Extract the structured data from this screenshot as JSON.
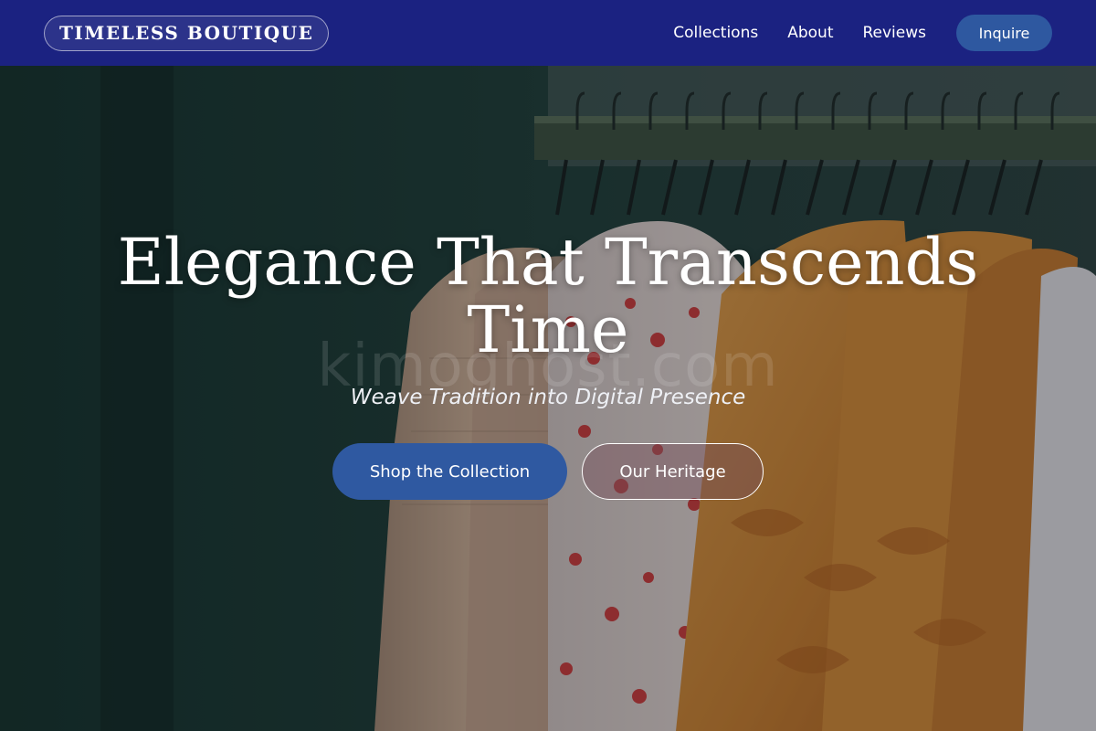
{
  "brand": {
    "name": "TIMELESS BOUTIQUE"
  },
  "nav": {
    "links": [
      "Collections",
      "About",
      "Reviews"
    ],
    "cta": "Inquire"
  },
  "hero": {
    "headline": "Elegance That Transcends Time",
    "tagline": "Weave Tradition into Digital Presence",
    "watermark": "kimoghost.com",
    "primary_button": "Shop the Collection",
    "secondary_button": "Our Heritage",
    "photo_subject": "rack-of-clothing-on-hangers"
  },
  "colors": {
    "nav_bg": "#1b2281",
    "primary_button": "#2f59a1",
    "garment_orange": "#d98f33",
    "garment_beige": "#c9a58a",
    "wall_green": "#1d3a33"
  }
}
